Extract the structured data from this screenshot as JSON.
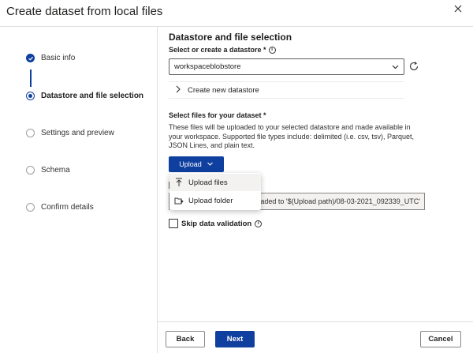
{
  "dialog": {
    "title": "Create dataset from local files"
  },
  "steps": [
    {
      "label": "Basic info",
      "state": "done"
    },
    {
      "label": "Datastore and file selection",
      "state": "active"
    },
    {
      "label": "Settings and preview",
      "state": "pending"
    },
    {
      "label": "Schema",
      "state": "pending"
    },
    {
      "label": "Confirm details",
      "state": "pending"
    }
  ],
  "main": {
    "section_title": "Datastore and file selection",
    "datastore_label": "Select or create a datastore *",
    "datastore_value": "workspaceblobstore",
    "create_new_label": "Create new datastore",
    "files_title": "Select files for your dataset *",
    "files_description": "These files will be uploaded to your selected datastore and made available in your workspace. Supported file types include: delimited (i.e. csv, tsv), Parquet, JSON Lines, and plain text.",
    "upload_label": "Upload",
    "upload_menu": [
      {
        "label": "Upload files",
        "icon": "upload-arrow-icon"
      },
      {
        "label": "Upload folder",
        "icon": "folder-upload-icon"
      }
    ],
    "upload_path_text": "aded to '$(Upload path)/08-03-2021_092339_UTC'",
    "skip_validation_label": "Skip data validation"
  },
  "footer": {
    "back_label": "Back",
    "next_label": "Next",
    "cancel_label": "Cancel"
  },
  "colors": {
    "accent": "#0f3f9f",
    "border": "#e1dfdd"
  }
}
